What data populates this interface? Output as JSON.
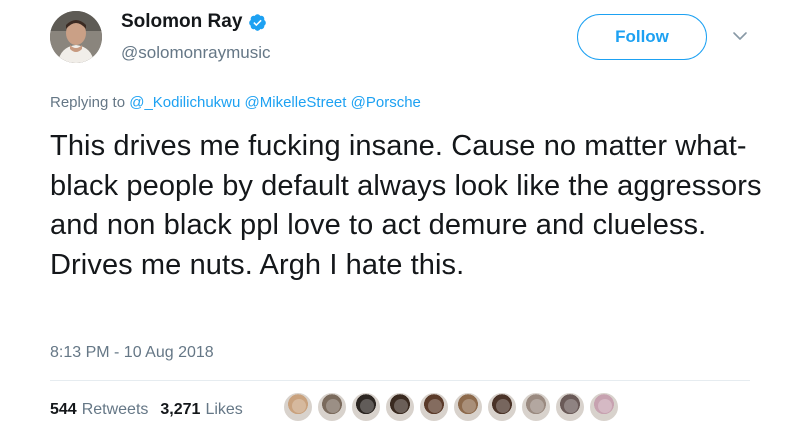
{
  "author": {
    "display_name": "Solomon Ray",
    "username": "@solomonraymusic",
    "verified": true,
    "avatar_icon": "user-avatar"
  },
  "follow_label": "Follow",
  "more_icon": "chevron-down-icon",
  "replying": {
    "prefix": "Replying to",
    "mentions": [
      "@_Kodilichukwu",
      "@MikelleStreet",
      "@Porsche"
    ]
  },
  "tweet": {
    "text": "This drives me fucking insane. Cause no matter what- black people by default always look like the aggressors and non black ppl love to act demure and clueless. Drives me nuts. Argh I hate this.",
    "timestamp": "8:13 PM - 10 Aug 2018"
  },
  "stats": {
    "retweets_count": "544",
    "retweets_label": "Retweets",
    "likes_count": "3,271",
    "likes_label": "Likes"
  },
  "likers": [
    {
      "color": "#c9a27e"
    },
    {
      "color": "#7a6a5c"
    },
    {
      "color": "#2c2622"
    },
    {
      "color": "#3a2a20"
    },
    {
      "color": "#5b3b2a"
    },
    {
      "color": "#8d6a4c"
    },
    {
      "color": "#4a3328"
    },
    {
      "color": "#9a8a80"
    },
    {
      "color": "#6a5a58"
    },
    {
      "color": "#c7a2b0"
    }
  ],
  "colors": {
    "accent": "#1da1f2",
    "secondary_text": "#657786",
    "primary_text": "#14171a"
  }
}
